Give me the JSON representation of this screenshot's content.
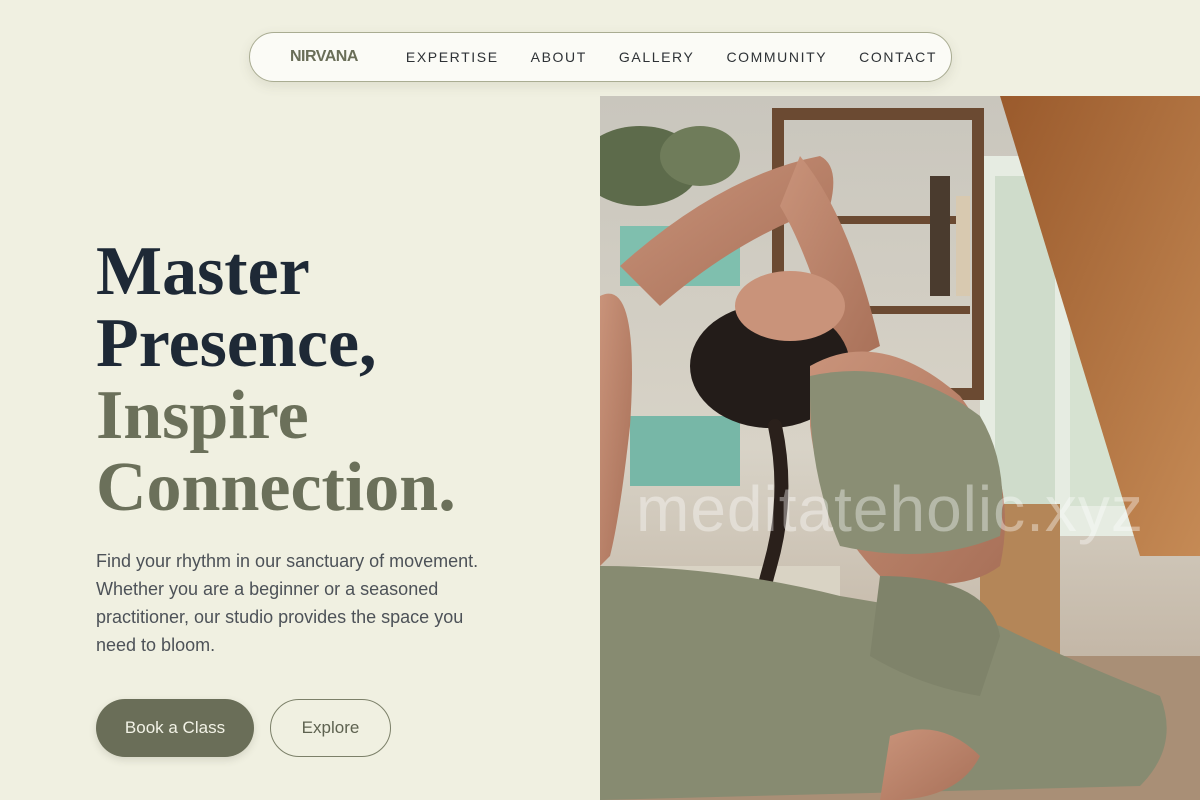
{
  "nav": {
    "brand": "NIRVANA",
    "links": [
      "EXPERTISE",
      "ABOUT",
      "GALLERY",
      "COMMUNITY",
      "CONTACT"
    ]
  },
  "hero": {
    "headline_line1": "Master",
    "headline_line2": "Presence,",
    "headline_line3": "Inspire",
    "headline_line4": "Connection.",
    "lead": "Find your rhythm in our sanctuary of movement. Whether you are a beginner or a seasoned practitioner, our studio provides the space you need to bloom.",
    "primary_button": "Book a Class",
    "secondary_button": "Explore",
    "image_icon": "yoga-pose-photo",
    "watermark": "meditateholic.xyz"
  },
  "colors": {
    "background": "#f0f0e1",
    "accent": "#6a6e58",
    "heading_dark": "#1e2936",
    "heading_muted": "#6b705a"
  }
}
